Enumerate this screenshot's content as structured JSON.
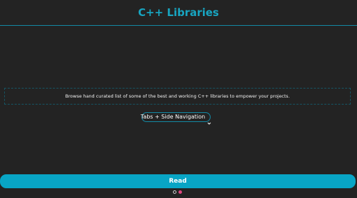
{
  "header": {
    "title": "C++ Libraries"
  },
  "main": {
    "description": "Browse hand curated list of some of the best and working C++ libraries to empower your projects.",
    "navigation_select": {
      "selected": "Tabs + Side Navigation",
      "icon": "chevron-down-icon"
    },
    "read_button_label": "Read"
  },
  "pagination": {
    "total": 2,
    "active_index": 1
  },
  "colors": {
    "background": "#232323",
    "accent": "#18a5c1",
    "button": "#08a5c5",
    "active_dot": "#e0457e"
  }
}
